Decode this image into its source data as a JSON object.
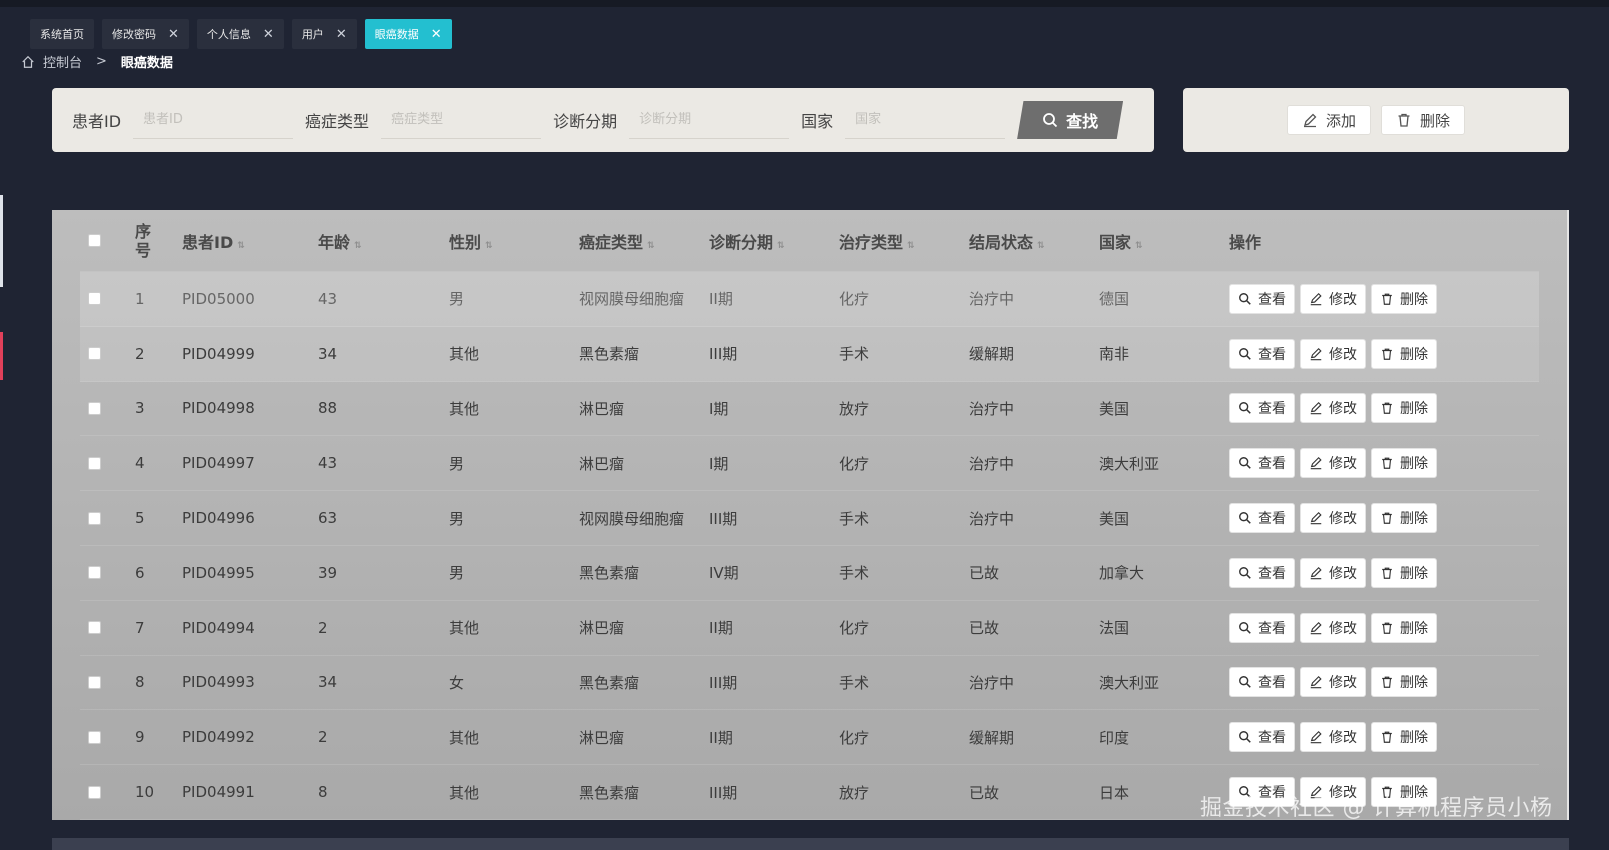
{
  "tabs": [
    {
      "label": "系统首页",
      "closable": false
    },
    {
      "label": "修改密码",
      "closable": true
    },
    {
      "label": "个人信息",
      "closable": true
    },
    {
      "label": "用户",
      "closable": true
    },
    {
      "label": "眼癌数据",
      "closable": true,
      "active": true
    }
  ],
  "breadcrumb": {
    "home": "控制台",
    "separator": ">",
    "current": "眼癌数据"
  },
  "search": {
    "patient_id_label": "患者ID",
    "patient_id_placeholder": "患者ID",
    "cancer_type_label": "癌症类型",
    "cancer_type_placeholder": "癌症类型",
    "stage_label": "诊断分期",
    "stage_placeholder": "诊断分期",
    "country_label": "国家",
    "country_placeholder": "国家",
    "button": "查找"
  },
  "actions": {
    "add": "添加",
    "delete": "删除"
  },
  "table": {
    "headers": {
      "index": "序号",
      "patient_id": "患者ID",
      "age": "年龄",
      "gender": "性别",
      "cancer_type": "癌症类型",
      "stage": "诊断分期",
      "treatment": "治疗类型",
      "outcome": "结局状态",
      "country": "国家",
      "ops": "操作"
    },
    "op_labels": {
      "view": "查看",
      "edit": "修改",
      "delete": "删除"
    },
    "rows": [
      [
        "1",
        "PID05000",
        "43",
        "男",
        "视网膜母细胞瘤",
        "II期",
        "化疗",
        "治疗中",
        "德国"
      ],
      [
        "2",
        "PID04999",
        "34",
        "其他",
        "黑色素瘤",
        "III期",
        "手术",
        "缓解期",
        "南非"
      ],
      [
        "3",
        "PID04998",
        "88",
        "其他",
        "淋巴瘤",
        "I期",
        "放疗",
        "治疗中",
        "美国"
      ],
      [
        "4",
        "PID04997",
        "43",
        "男",
        "淋巴瘤",
        "I期",
        "化疗",
        "治疗中",
        "澳大利亚"
      ],
      [
        "5",
        "PID04996",
        "63",
        "男",
        "视网膜母细胞瘤",
        "III期",
        "手术",
        "治疗中",
        "美国"
      ],
      [
        "6",
        "PID04995",
        "39",
        "男",
        "黑色素瘤",
        "IV期",
        "手术",
        "已故",
        "加拿大"
      ],
      [
        "7",
        "PID04994",
        "2",
        "其他",
        "淋巴瘤",
        "II期",
        "化疗",
        "已故",
        "法国"
      ],
      [
        "8",
        "PID04993",
        "34",
        "女",
        "黑色素瘤",
        "III期",
        "手术",
        "治疗中",
        "澳大利亚"
      ],
      [
        "9",
        "PID04992",
        "2",
        "其他",
        "淋巴瘤",
        "II期",
        "化疗",
        "缓解期",
        "印度"
      ],
      [
        "10",
        "PID04991",
        "8",
        "其他",
        "黑色素瘤",
        "III期",
        "放疗",
        "已故",
        "日本"
      ]
    ]
  },
  "watermark": "掘金技术社区 @ 计算机程序员小杨"
}
